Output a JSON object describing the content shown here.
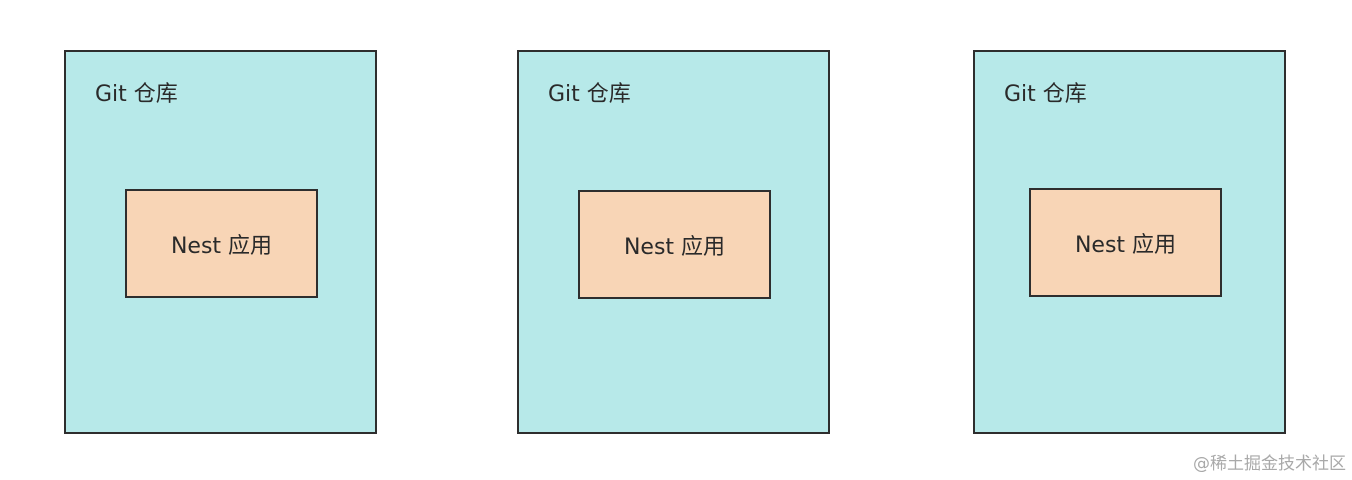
{
  "repos": [
    {
      "title": "Git 仓库",
      "app": "Nest 应用"
    },
    {
      "title": "Git 仓库",
      "app": "Nest 应用"
    },
    {
      "title": "Git 仓库",
      "app": "Nest 应用"
    }
  ],
  "colors": {
    "repo_fill": "#b7e9e9",
    "app_fill": "#f8d5b6",
    "stroke": "#2e2e2e"
  },
  "watermark": "@稀土掘金技术社区"
}
